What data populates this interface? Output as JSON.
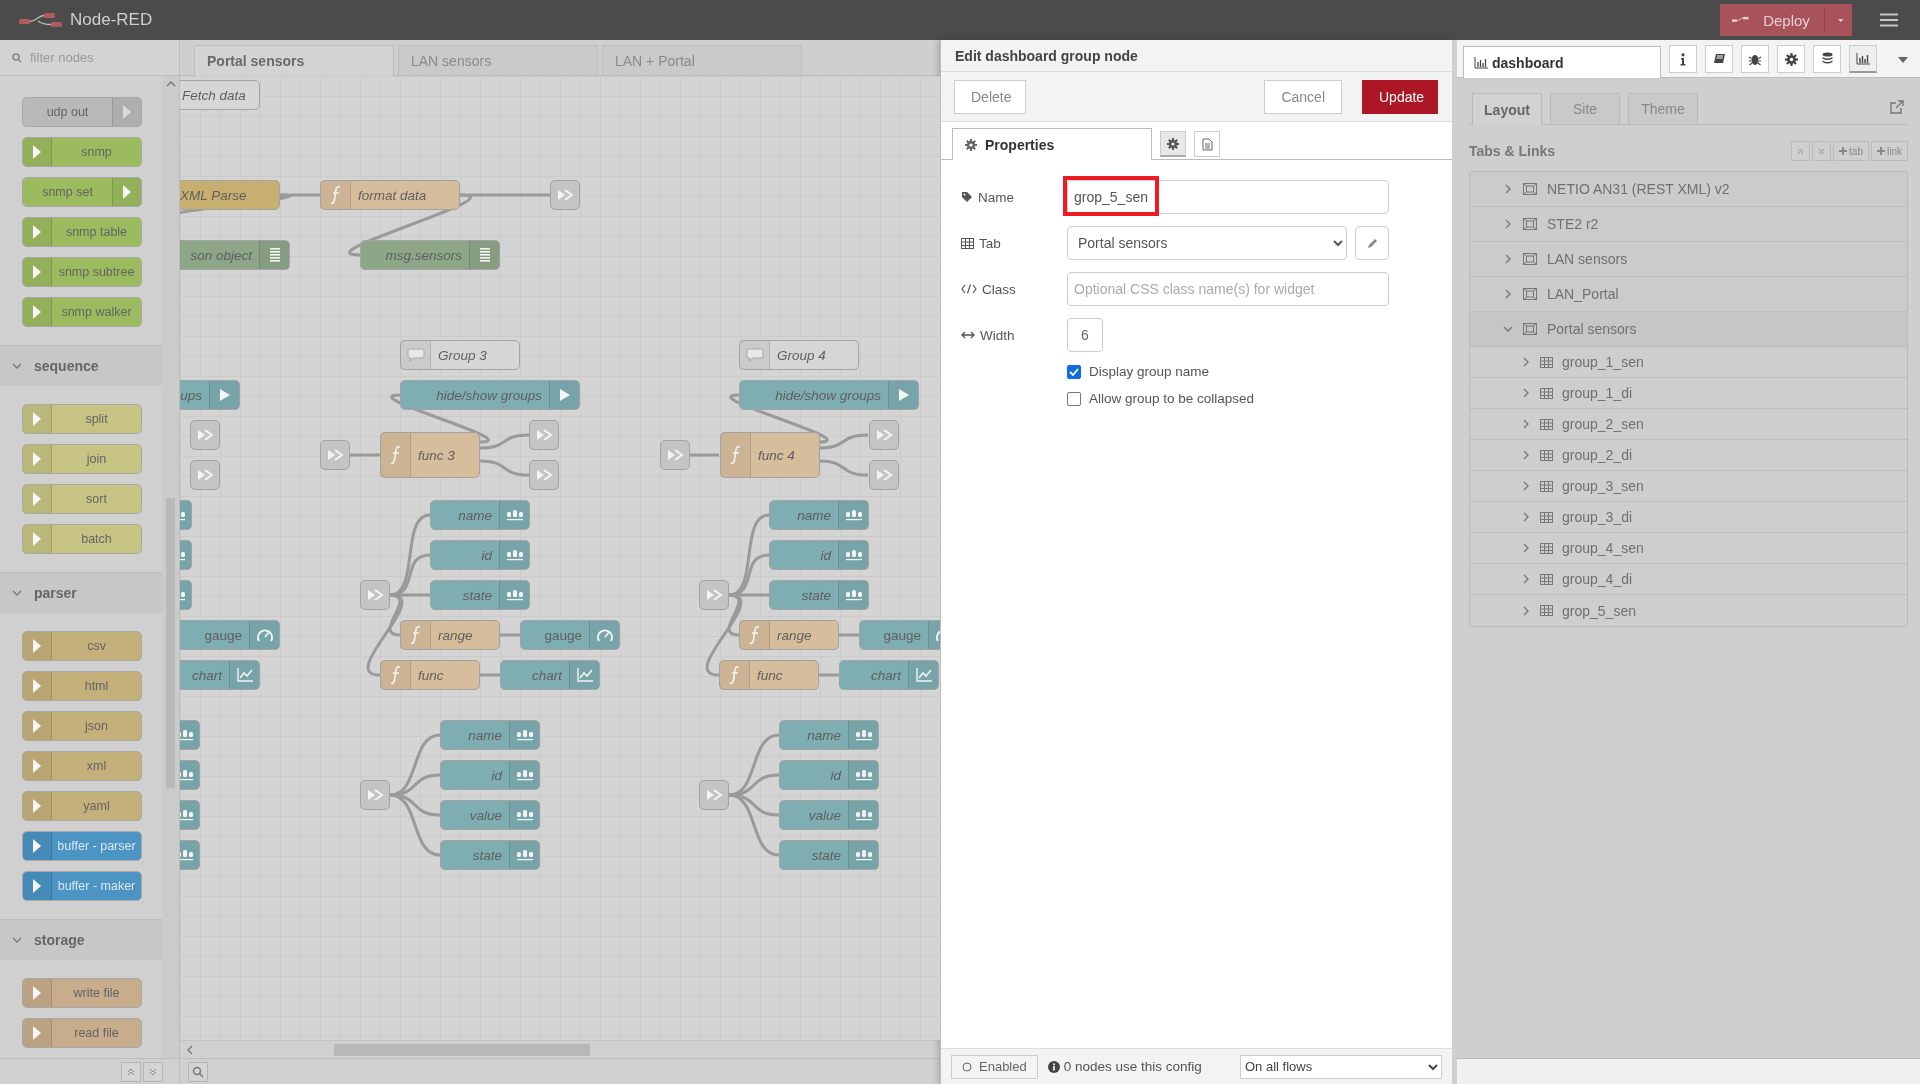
{
  "header": {
    "title": "Node-RED",
    "deploy": "Deploy"
  },
  "palette": {
    "placeholder": "filter nodes",
    "groups": [
      {
        "nodes": [
          {
            "kind": "network",
            "label": "udp out",
            "icon_right": true
          },
          {
            "kind": "snmp",
            "label": "snmp",
            "icon_right": false
          },
          {
            "kind": "snmp",
            "label": "snmp set",
            "icon_right": true
          },
          {
            "kind": "snmp",
            "label": "snmp table",
            "icon_right": false
          },
          {
            "kind": "snmp",
            "label": "snmp subtree",
            "icon_right": false
          },
          {
            "kind": "snmp",
            "label": "snmp walker",
            "icon_right": false
          }
        ]
      },
      {
        "title": "sequence",
        "expanded": true,
        "nodes": [
          {
            "kind": "sequence",
            "label": "split",
            "icon_right": false
          },
          {
            "kind": "sequence",
            "label": "join",
            "icon_right": false
          },
          {
            "kind": "sequence",
            "label": "sort",
            "icon_right": false
          },
          {
            "kind": "sequence",
            "label": "batch",
            "icon_right": false
          }
        ]
      },
      {
        "title": "parser",
        "expanded": true,
        "nodes": [
          {
            "kind": "parser",
            "label": "csv",
            "icon_right": false
          },
          {
            "kind": "parser",
            "label": "html",
            "icon_right": false
          },
          {
            "kind": "parser",
            "label": "json",
            "icon_right": false
          },
          {
            "kind": "parser",
            "label": "xml",
            "icon_right": false
          },
          {
            "kind": "parser",
            "label": "yaml",
            "icon_right": false
          },
          {
            "kind": "buffer",
            "label": "buffer - parser",
            "icon_right": false
          },
          {
            "kind": "buffer",
            "label": "buffer - maker",
            "icon_right": false
          }
        ]
      },
      {
        "title": "storage",
        "expanded": true,
        "nodes": [
          {
            "kind": "storage",
            "label": "write file",
            "icon_right": false
          },
          {
            "kind": "storage",
            "label": "read file",
            "icon_right": false
          }
        ]
      }
    ]
  },
  "workspace": {
    "tabs": [
      {
        "label": "Portal sensors",
        "selected": true
      },
      {
        "label": "LAN sensors",
        "selected": false
      },
      {
        "label": "LAN + Portal",
        "selected": false
      }
    ],
    "nodes": [
      {
        "kind": "comment",
        "label": "Fetch data"
      },
      {
        "kind": "parser",
        "label": "XML Parse"
      },
      {
        "kind": "function",
        "label": "format data"
      },
      {
        "kind": "link"
      },
      {
        "kind": "debug",
        "label": "son object"
      },
      {
        "kind": "debug",
        "label": "msg.sensors"
      },
      {
        "kind": "comment",
        "label": "Group 3"
      },
      {
        "kind": "comment",
        "label": "Group 4"
      },
      {
        "kind": "ui",
        "label": "ups"
      },
      {
        "kind": "ui",
        "label": "hide/show groups"
      },
      {
        "kind": "ui",
        "label": "hide/show groups"
      },
      {
        "kind": "link"
      },
      {
        "kind": "function",
        "label": "func 3"
      },
      {
        "kind": "link"
      },
      {
        "kind": "link"
      },
      {
        "kind": "link"
      },
      {
        "kind": "function",
        "label": "func 4"
      },
      {
        "kind": "link"
      },
      {
        "kind": "link"
      },
      {
        "kind": "link"
      },
      {
        "kind": "link"
      },
      {
        "kind": "ui",
        "label": "gauge"
      },
      {
        "kind": "ui",
        "label": "chart"
      },
      {
        "kind": "ui"
      },
      {
        "kind": "ui"
      },
      {
        "kind": "ui"
      },
      {
        "kind": "ui"
      },
      {
        "kind": "ui"
      },
      {
        "kind": "ui"
      },
      {
        "kind": "ui"
      },
      {
        "kind": "ui",
        "label": "name"
      },
      {
        "kind": "ui",
        "label": "id"
      },
      {
        "kind": "ui",
        "label": "state"
      },
      {
        "kind": "link"
      },
      {
        "kind": "function",
        "label": "range"
      },
      {
        "kind": "ui",
        "label": "gauge"
      },
      {
        "kind": "function",
        "label": "func"
      },
      {
        "kind": "ui",
        "label": "chart"
      },
      {
        "kind": "ui",
        "label": "name"
      },
      {
        "kind": "ui",
        "label": "id"
      },
      {
        "kind": "ui",
        "label": "value"
      },
      {
        "kind": "ui",
        "label": "state"
      },
      {
        "kind": "link"
      },
      {
        "kind": "ui",
        "label": "name"
      },
      {
        "kind": "ui",
        "label": "id"
      },
      {
        "kind": "ui",
        "label": "state"
      },
      {
        "kind": "link"
      },
      {
        "kind": "function",
        "label": "range"
      },
      {
        "kind": "ui",
        "label": "gauge"
      },
      {
        "kind": "function",
        "label": "func"
      },
      {
        "kind": "ui",
        "label": "chart"
      },
      {
        "kind": "ui",
        "label": "name"
      },
      {
        "kind": "ui",
        "label": "id"
      },
      {
        "kind": "ui",
        "label": "value"
      },
      {
        "kind": "ui",
        "label": "state"
      },
      {
        "kind": "link"
      }
    ]
  },
  "editor": {
    "title": "Edit dashboard group node",
    "delete": "Delete",
    "cancel": "Cancel",
    "update": "Update",
    "tabs": [
      {
        "label": "Properties",
        "selected": true
      }
    ],
    "fields": [
      {
        "kind": "text",
        "label": "Name",
        "value": "grop_5_sen",
        "highlighted": true
      },
      {
        "kind": "select",
        "label": "Tab",
        "value": "Portal sensors"
      },
      {
        "kind": "text",
        "label": "Class",
        "placeholder": "Optional CSS class name(s) for widget",
        "highlighted": false
      },
      {
        "kind": "number",
        "label": "Width",
        "value": "6"
      },
      {
        "kind": "checkbox",
        "label": "Display group name",
        "checked": true
      },
      {
        "kind": "checkbox",
        "label": "Allow group to be collapsed",
        "checked": false
      }
    ],
    "footer": {
      "enabled": "Enabled",
      "info": "0 nodes use this config",
      "scope": "On all flows"
    }
  },
  "sidebar": {
    "tab": "dashboard",
    "buttons": [
      {
        "selected": false
      },
      {
        "selected": false
      },
      {
        "selected": false
      },
      {
        "selected": false
      },
      {
        "selected": false
      },
      {
        "selected": true
      }
    ],
    "subtabs": [
      {
        "label": "Layout",
        "selected": true
      },
      {
        "label": "Site",
        "selected": false
      },
      {
        "label": "Theme",
        "selected": false
      }
    ],
    "section": "Tabs & Links",
    "add_buttons": [
      "tab",
      "link"
    ],
    "tree": [
      {
        "label": "NETIO AN31 (REST XML) v2",
        "expanded": false
      },
      {
        "label": "STE2 r2",
        "expanded": false
      },
      {
        "label": "LAN sensors",
        "expanded": false
      },
      {
        "label": "LAN_Portal",
        "expanded": false
      },
      {
        "label": "Portal sensors",
        "expanded": true,
        "children": [
          {
            "label": "group_1_sen",
            "expanded": false
          },
          {
            "label": "group_1_di",
            "expanded": false
          },
          {
            "label": "group_2_sen",
            "expanded": false
          },
          {
            "label": "group_2_di",
            "expanded": false
          },
          {
            "label": "group_3_sen",
            "expanded": false
          },
          {
            "label": "group_3_di",
            "expanded": false
          },
          {
            "label": "group_4_sen",
            "expanded": false
          },
          {
            "label": "group_4_di",
            "expanded": false
          },
          {
            "label": "grop_5_sen",
            "expanded": false
          }
        ]
      }
    ]
  }
}
